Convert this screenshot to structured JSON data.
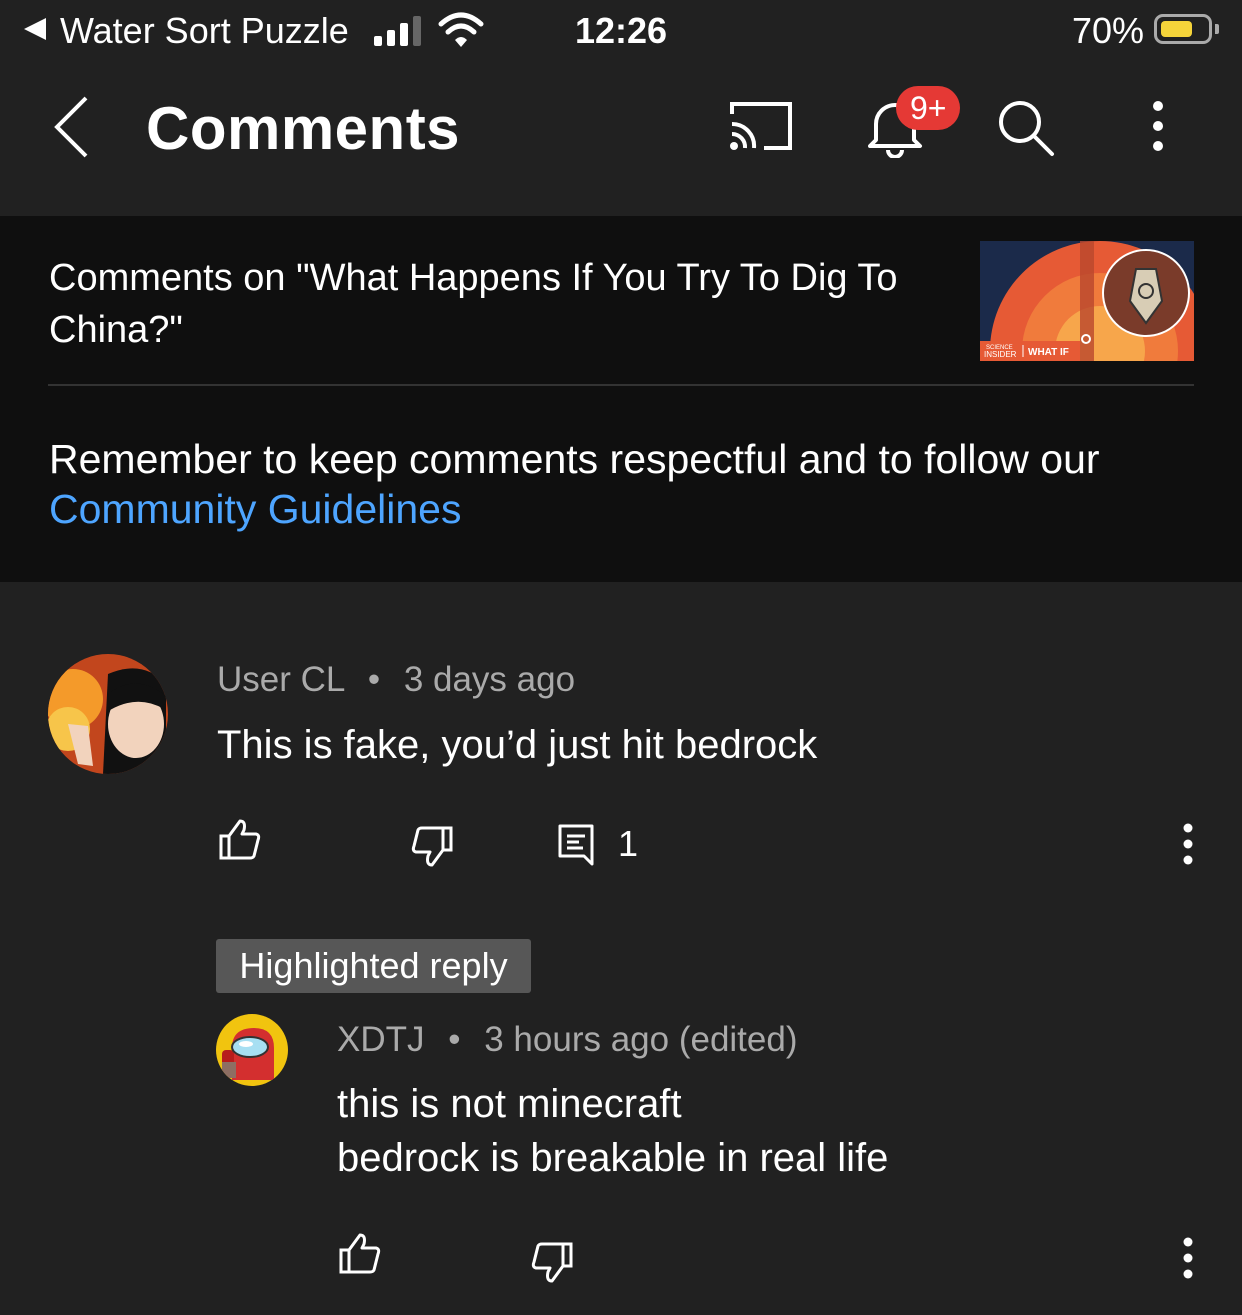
{
  "status_bar": {
    "back_app": "Water Sort Puzzle",
    "time": "12:26",
    "battery_percent_label": "70%",
    "battery_level": 0.7
  },
  "header": {
    "title": "Comments",
    "notification_badge": "9+"
  },
  "video": {
    "title": "Comments on \"What Happens If You Try To Dig To China?\"",
    "thumbnail_brand_small": "SCIENCE",
    "thumbnail_brand": "INSIDER",
    "thumbnail_series": "WHAT IF"
  },
  "reminder": {
    "text": "Remember to keep comments respectful and to follow our",
    "link": "Community Guidelines"
  },
  "comments": [
    {
      "author": "User CL",
      "separator": "•",
      "time": "3 days ago",
      "text": "This is fake, you’d just hit bedrock",
      "reply_count": "1"
    }
  ],
  "highlighted_label": "Highlighted reply",
  "reply": {
    "author": "XDTJ",
    "separator": "•",
    "time": "3 hours ago (edited)",
    "line1": "this is not minecraft",
    "line2": "bedrock is breakable in real life"
  },
  "colors": {
    "background": "#212121",
    "panel": "#0f0f0f",
    "link": "#4ea5ff",
    "badge": "#e53935",
    "battery": "#f5d43a"
  }
}
